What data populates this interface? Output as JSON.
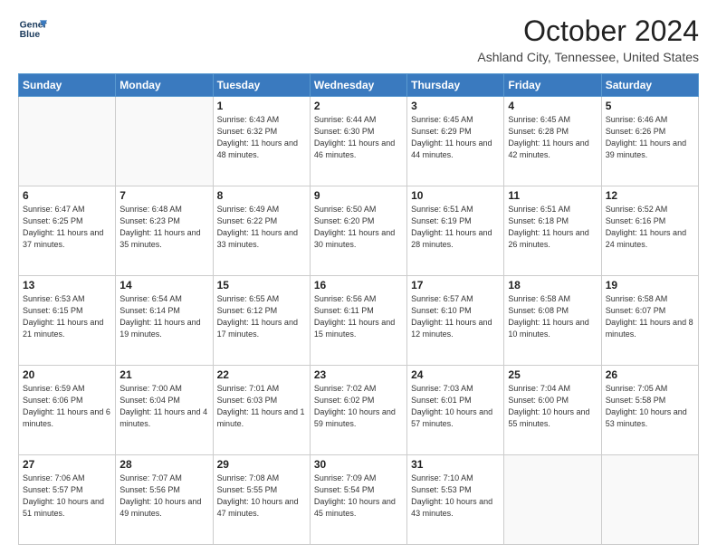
{
  "header": {
    "logo_line1": "General",
    "logo_line2": "Blue",
    "month_title": "October 2024",
    "location": "Ashland City, Tennessee, United States"
  },
  "weekdays": [
    "Sunday",
    "Monday",
    "Tuesday",
    "Wednesday",
    "Thursday",
    "Friday",
    "Saturday"
  ],
  "weeks": [
    [
      {
        "day": "",
        "info": ""
      },
      {
        "day": "",
        "info": ""
      },
      {
        "day": "1",
        "info": "Sunrise: 6:43 AM\nSunset: 6:32 PM\nDaylight: 11 hours and 48 minutes."
      },
      {
        "day": "2",
        "info": "Sunrise: 6:44 AM\nSunset: 6:30 PM\nDaylight: 11 hours and 46 minutes."
      },
      {
        "day": "3",
        "info": "Sunrise: 6:45 AM\nSunset: 6:29 PM\nDaylight: 11 hours and 44 minutes."
      },
      {
        "day": "4",
        "info": "Sunrise: 6:45 AM\nSunset: 6:28 PM\nDaylight: 11 hours and 42 minutes."
      },
      {
        "day": "5",
        "info": "Sunrise: 6:46 AM\nSunset: 6:26 PM\nDaylight: 11 hours and 39 minutes."
      }
    ],
    [
      {
        "day": "6",
        "info": "Sunrise: 6:47 AM\nSunset: 6:25 PM\nDaylight: 11 hours and 37 minutes."
      },
      {
        "day": "7",
        "info": "Sunrise: 6:48 AM\nSunset: 6:23 PM\nDaylight: 11 hours and 35 minutes."
      },
      {
        "day": "8",
        "info": "Sunrise: 6:49 AM\nSunset: 6:22 PM\nDaylight: 11 hours and 33 minutes."
      },
      {
        "day": "9",
        "info": "Sunrise: 6:50 AM\nSunset: 6:20 PM\nDaylight: 11 hours and 30 minutes."
      },
      {
        "day": "10",
        "info": "Sunrise: 6:51 AM\nSunset: 6:19 PM\nDaylight: 11 hours and 28 minutes."
      },
      {
        "day": "11",
        "info": "Sunrise: 6:51 AM\nSunset: 6:18 PM\nDaylight: 11 hours and 26 minutes."
      },
      {
        "day": "12",
        "info": "Sunrise: 6:52 AM\nSunset: 6:16 PM\nDaylight: 11 hours and 24 minutes."
      }
    ],
    [
      {
        "day": "13",
        "info": "Sunrise: 6:53 AM\nSunset: 6:15 PM\nDaylight: 11 hours and 21 minutes."
      },
      {
        "day": "14",
        "info": "Sunrise: 6:54 AM\nSunset: 6:14 PM\nDaylight: 11 hours and 19 minutes."
      },
      {
        "day": "15",
        "info": "Sunrise: 6:55 AM\nSunset: 6:12 PM\nDaylight: 11 hours and 17 minutes."
      },
      {
        "day": "16",
        "info": "Sunrise: 6:56 AM\nSunset: 6:11 PM\nDaylight: 11 hours and 15 minutes."
      },
      {
        "day": "17",
        "info": "Sunrise: 6:57 AM\nSunset: 6:10 PM\nDaylight: 11 hours and 12 minutes."
      },
      {
        "day": "18",
        "info": "Sunrise: 6:58 AM\nSunset: 6:08 PM\nDaylight: 11 hours and 10 minutes."
      },
      {
        "day": "19",
        "info": "Sunrise: 6:58 AM\nSunset: 6:07 PM\nDaylight: 11 hours and 8 minutes."
      }
    ],
    [
      {
        "day": "20",
        "info": "Sunrise: 6:59 AM\nSunset: 6:06 PM\nDaylight: 11 hours and 6 minutes."
      },
      {
        "day": "21",
        "info": "Sunrise: 7:00 AM\nSunset: 6:04 PM\nDaylight: 11 hours and 4 minutes."
      },
      {
        "day": "22",
        "info": "Sunrise: 7:01 AM\nSunset: 6:03 PM\nDaylight: 11 hours and 1 minute."
      },
      {
        "day": "23",
        "info": "Sunrise: 7:02 AM\nSunset: 6:02 PM\nDaylight: 10 hours and 59 minutes."
      },
      {
        "day": "24",
        "info": "Sunrise: 7:03 AM\nSunset: 6:01 PM\nDaylight: 10 hours and 57 minutes."
      },
      {
        "day": "25",
        "info": "Sunrise: 7:04 AM\nSunset: 6:00 PM\nDaylight: 10 hours and 55 minutes."
      },
      {
        "day": "26",
        "info": "Sunrise: 7:05 AM\nSunset: 5:58 PM\nDaylight: 10 hours and 53 minutes."
      }
    ],
    [
      {
        "day": "27",
        "info": "Sunrise: 7:06 AM\nSunset: 5:57 PM\nDaylight: 10 hours and 51 minutes."
      },
      {
        "day": "28",
        "info": "Sunrise: 7:07 AM\nSunset: 5:56 PM\nDaylight: 10 hours and 49 minutes."
      },
      {
        "day": "29",
        "info": "Sunrise: 7:08 AM\nSunset: 5:55 PM\nDaylight: 10 hours and 47 minutes."
      },
      {
        "day": "30",
        "info": "Sunrise: 7:09 AM\nSunset: 5:54 PM\nDaylight: 10 hours and 45 minutes."
      },
      {
        "day": "31",
        "info": "Sunrise: 7:10 AM\nSunset: 5:53 PM\nDaylight: 10 hours and 43 minutes."
      },
      {
        "day": "",
        "info": ""
      },
      {
        "day": "",
        "info": ""
      }
    ]
  ]
}
